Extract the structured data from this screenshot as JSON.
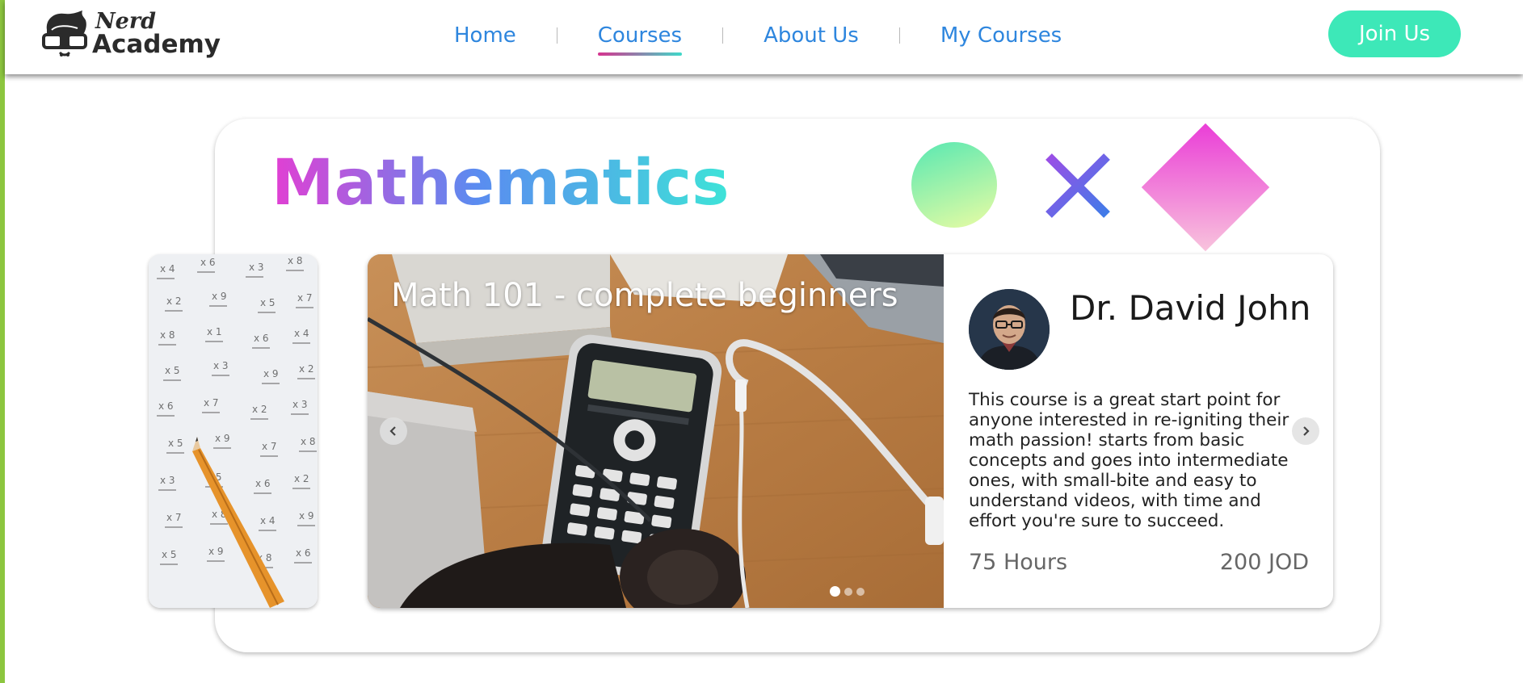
{
  "brand": {
    "line1": "Nerd",
    "line2": "Academy"
  },
  "nav": {
    "items": [
      {
        "label": "Home",
        "active": false
      },
      {
        "label": "Courses",
        "active": true
      },
      {
        "label": "About Us",
        "active": false
      },
      {
        "label": "My Courses",
        "active": false
      }
    ],
    "join_label": "Join Us"
  },
  "colors": {
    "nav_link": "#2e86de",
    "join_button": "#3de8b8",
    "accent_gradient": [
      "#d6338f",
      "#3fd9c9"
    ],
    "left_strip": "#8cc63f"
  },
  "subject": {
    "title": "Mathematics"
  },
  "course": {
    "title": "Math 101 - complete beginners",
    "instructor": "Dr. David John",
    "description": "This course is a great start point for anyone interested in re-igniting their math passion! starts from basic concepts and goes into intermediate ones, with small-bite and easy to understand videos, with time and effort you're sure to succeed.",
    "hours": "75 Hours",
    "price": "200 JOD",
    "slides_total": 3,
    "slide_active": 1
  },
  "icons": {
    "prev": "chevron-left-icon",
    "next": "chevron-right-icon",
    "decor": [
      "circle-shape",
      "x-shape",
      "diamond-shape"
    ]
  }
}
